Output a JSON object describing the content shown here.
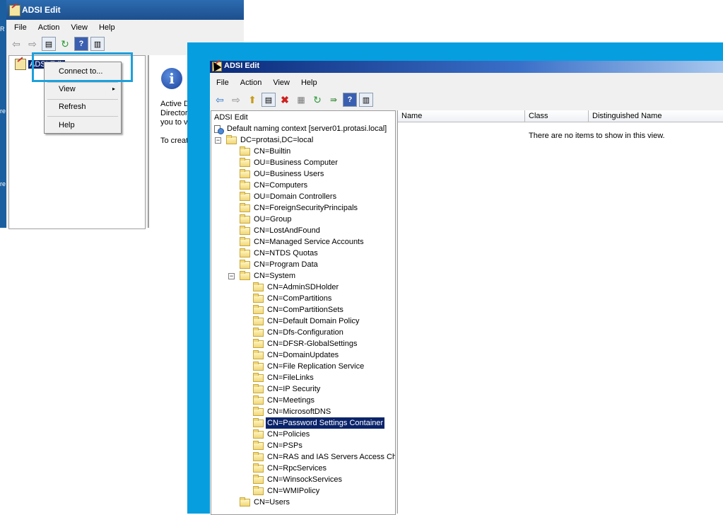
{
  "background_window": {
    "title": "ADSI Edit",
    "menu": [
      "File",
      "Action",
      "View",
      "Help"
    ],
    "tree_root": "ADSI Edit",
    "right_pane_lines": [
      "Active D",
      "Director",
      "you to v",
      "To creat"
    ],
    "side_letters": [
      "R",
      "re",
      "re"
    ]
  },
  "context_menu": {
    "items": [
      {
        "label": "Connect to..."
      },
      {
        "label": "View",
        "has_submenu": true
      },
      {
        "label": "Refresh"
      },
      {
        "label": "Help"
      }
    ],
    "submenu_arrow": "▸"
  },
  "main_window": {
    "title": "ADSI Edit",
    "menu": [
      "File",
      "Action",
      "View",
      "Help"
    ],
    "tree": {
      "root": "ADSI Edit",
      "context": "Default naming context [server01.protasi.local]",
      "domain": "DC=protasi,DC=local",
      "domain_children": [
        "CN=Builtin",
        "OU=Business Computer",
        "OU=Business Users",
        "CN=Computers",
        "OU=Domain Controllers",
        "CN=ForeignSecurityPrincipals",
        "OU=Group",
        "CN=LostAndFound",
        "CN=Managed Service Accounts",
        "CN=NTDS Quotas",
        "CN=Program Data"
      ],
      "system": "CN=System",
      "system_children": [
        "CN=AdminSDHolder",
        "CN=ComPartitions",
        "CN=ComPartitionSets",
        "CN=Default Domain Policy",
        "CN=Dfs-Configuration",
        "CN=DFSR-GlobalSettings",
        "CN=DomainUpdates",
        "CN=File Replication Service",
        "CN=FileLinks",
        "CN=IP Security",
        "CN=Meetings",
        "CN=MicrosoftDNS",
        "CN=Password Settings Container",
        "CN=Policies",
        "CN=PSPs",
        "CN=RAS and IAS Servers Access Che",
        "CN=RpcServices",
        "CN=WinsockServices",
        "CN=WMIPolicy"
      ],
      "selected": "CN=Password Settings Container",
      "after_system": [
        "CN=Users"
      ]
    },
    "columns": [
      "Name",
      "Class",
      "Distinguished Name"
    ],
    "empty_message": "There are no items to show in this view."
  },
  "colors": {
    "backdrop": "#079ee0",
    "highlight_box": "#1ea0dc",
    "selection": "#0a246a"
  }
}
